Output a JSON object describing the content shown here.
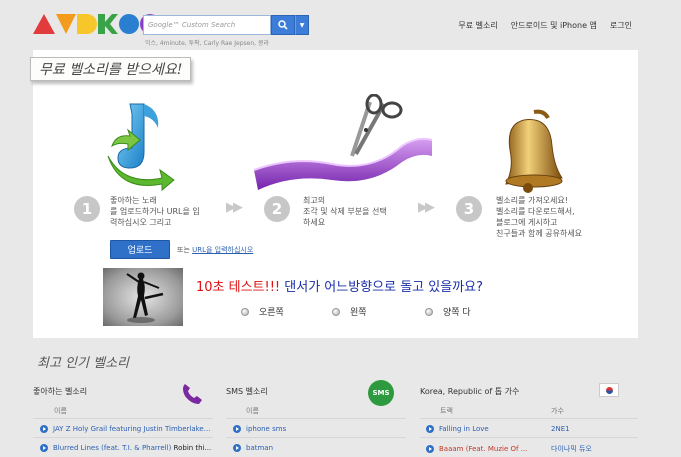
{
  "search": {
    "placeholder": "Google™ Custom Search",
    "hint": "익스, 4minute, 투팍, Carly Rae Jepsen, 콩라"
  },
  "nav": {
    "ringtones": "무료 벨소리",
    "apps": "안드로이드 및 iPhone 앱",
    "login": "로그인"
  },
  "banner": "무료 벨소리를 받으세요!",
  "steps": [
    {
      "num": "1",
      "text_lines": [
        "좋아하는 노래",
        "를 업로드하거나 URL을 입",
        "력하십시오 그리고"
      ]
    },
    {
      "num": "2",
      "text_lines": [
        "최고의",
        "조각 및 삭제 부분을 선택",
        "하세요"
      ]
    },
    {
      "num": "3",
      "text_lines": [
        "벨소리를 가져오세요!",
        " 벨소리를 다운로드해서,",
        "블로그에 게시하고",
        "친구들과 함께 공유하세요"
      ]
    }
  ],
  "upload": {
    "button": "업로드",
    "prefix": "또는",
    "link": "URL을 입력하십시오"
  },
  "quiz": {
    "red": "10초 테스트!!!",
    "blue": " 댄서가 어느방향으로 돌고 있을까요?",
    "options": [
      "오른쪽",
      "왼쪽",
      "양쪽 다"
    ]
  },
  "popular": {
    "title": "최고 인기 벨소리",
    "col1": {
      "title": "좋아하는 벨소리",
      "sub": "이름",
      "rows": [
        {
          "t": "JAY Z Holy Grail featuring Justin Timberlake...",
          "a": ""
        },
        {
          "t": "Blurred Lines (feat. T.I. & Pharrell)",
          "a": "Robin thi..."
        }
      ]
    },
    "col2": {
      "title": "SMS 벨소리",
      "sub": "이름",
      "rows": [
        {
          "t": "iphone sms"
        },
        {
          "t": "batman"
        }
      ]
    },
    "col3": {
      "title": "Korea, Republic of 톱 가수",
      "sub1": "트랙",
      "sub2": "가수",
      "rows": [
        {
          "t": "Falling in Love",
          "a": "2NE1"
        },
        {
          "t": "Baaam (Feat. Muzie Of ...",
          "a": "다이나믹 듀오"
        }
      ]
    },
    "sms_badge": "SMS"
  },
  "icons": {
    "search": "search-icon",
    "phone": "phone-icon",
    "flag": "korea-flag-icon"
  }
}
